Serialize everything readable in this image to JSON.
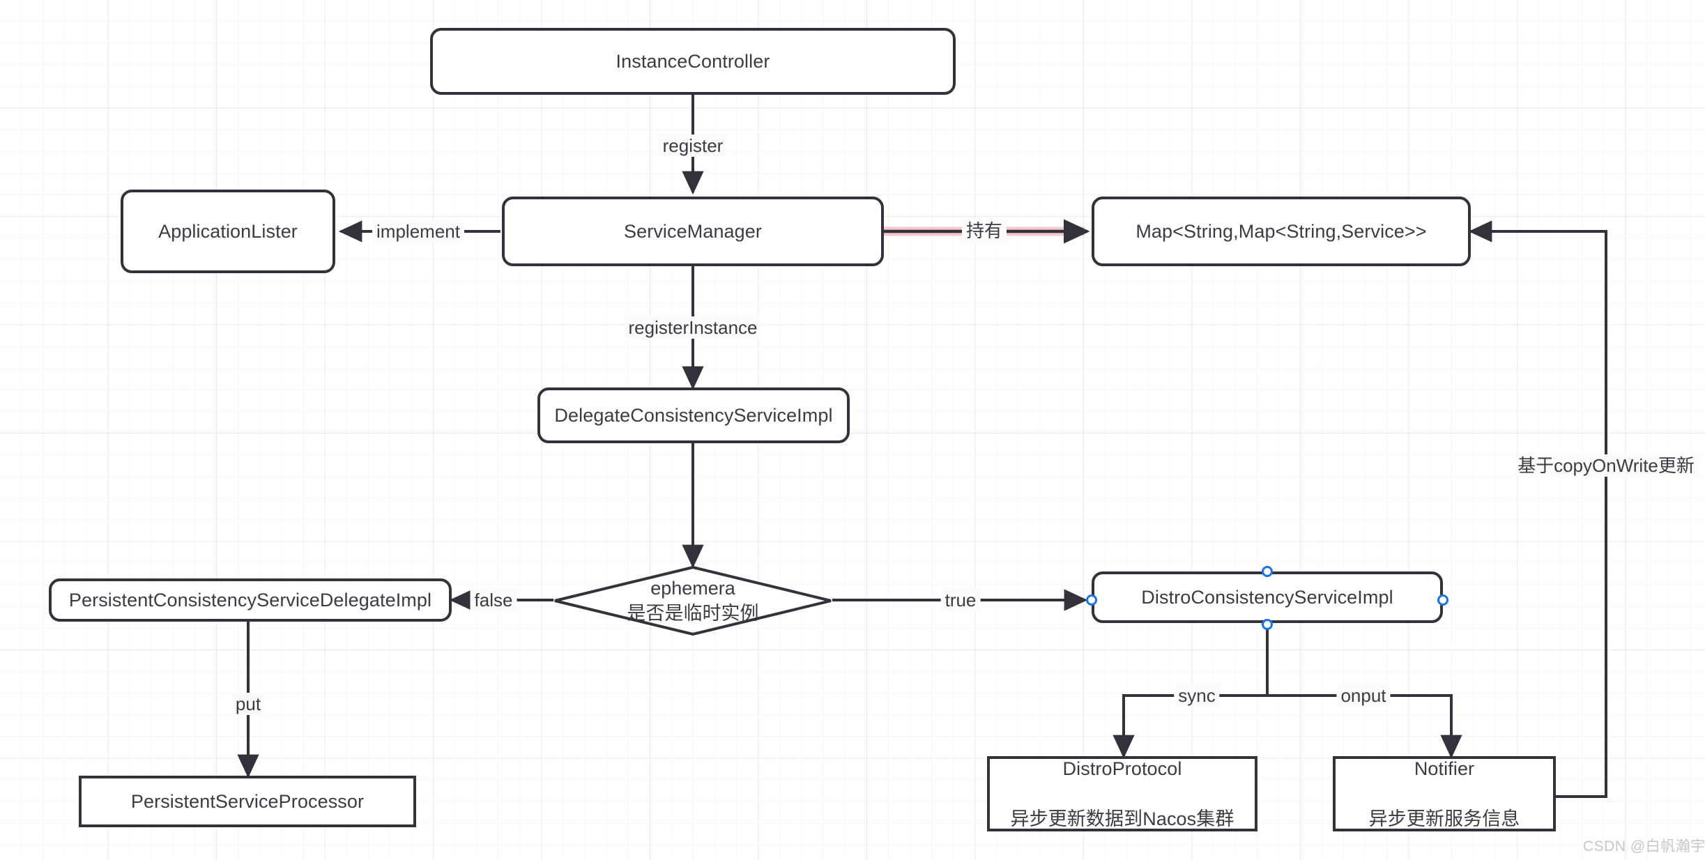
{
  "diagram": {
    "title": "Nacos InstanceController register flow",
    "theme": {
      "node_stroke": "#32323a",
      "node_fill": "#ffffff",
      "text": "#3b3b42",
      "edge": "#32323a",
      "highlight_edge": "#f3c5c5",
      "handle": "#1a73e8",
      "grid": "#eeeeee",
      "watermark": "#c3c7cc"
    },
    "nodes": {
      "instance_controller": {
        "label": "InstanceController"
      },
      "application_lister": {
        "label": "ApplicationLister"
      },
      "service_manager": {
        "label": "ServiceManager"
      },
      "service_map": {
        "label": "Map<String,Map<String,Service>>"
      },
      "delegate_consistency": {
        "label": "DelegateConsistencyServiceImpl"
      },
      "ephemera_decision": {
        "label_line1": "ephemera",
        "label_line2": "是否是临时实例"
      },
      "persistent_delegate": {
        "label": "PersistentConsistencyServiceDelegateImpl"
      },
      "distro_consistency": {
        "label": "DistroConsistencyServiceImpl"
      },
      "persistent_processor": {
        "label": "PersistentServiceProcessor"
      },
      "distro_protocol": {
        "label_line1": "DistroProtocol",
        "label_line2": "异步更新数据到Nacos集群"
      },
      "notifier": {
        "label_line1": "Notifier",
        "label_line2": "异步更新服务信息"
      }
    },
    "edge_labels": {
      "register": "register",
      "implement": "implement",
      "hold": "持有",
      "register_instance": "registerInstance",
      "decision_false": "false",
      "decision_true": "true",
      "put": "put",
      "sync": "sync",
      "onput": "onput",
      "copy_on_write": "基于copyOnWrite更新"
    },
    "watermark": "CSDN @白帆瀚宇"
  }
}
